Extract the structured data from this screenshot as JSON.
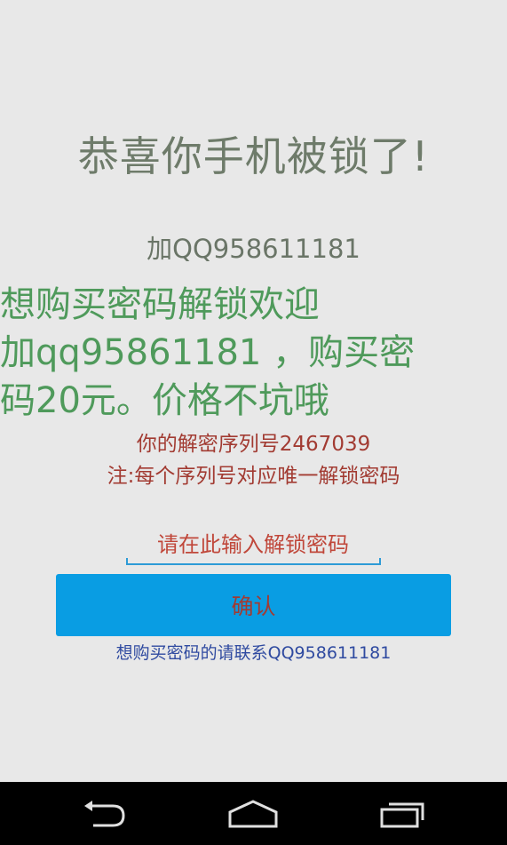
{
  "main": {
    "title": "恭喜你手机被锁了!",
    "qq_line": "加QQ958611181",
    "promo_lines": [
      "想购买密码解锁欢迎",
      "加qq95861181 ，购买密",
      "码20元。价格不坑哦"
    ],
    "serial_text": "你的解密序列号2467039",
    "note_text": "注:每个序列号对应唯一解锁密码",
    "password_input": {
      "placeholder": "请在此输入解锁密码",
      "value": ""
    },
    "confirm_label": "确认",
    "contact_text": "想购买密码的请联系QQ958611181"
  },
  "navbar": {
    "buttons": [
      {
        "icon": "back-icon"
      },
      {
        "icon": "home-icon"
      },
      {
        "icon": "recent-apps-icon"
      }
    ]
  },
  "colors": {
    "background": "#e8e8e8",
    "title": "#6e7b6a",
    "promo": "#4f9a5b",
    "warning": "#a23b32",
    "button": "#099de3",
    "contact": "#2f4aa0",
    "navbar": "#000000"
  }
}
